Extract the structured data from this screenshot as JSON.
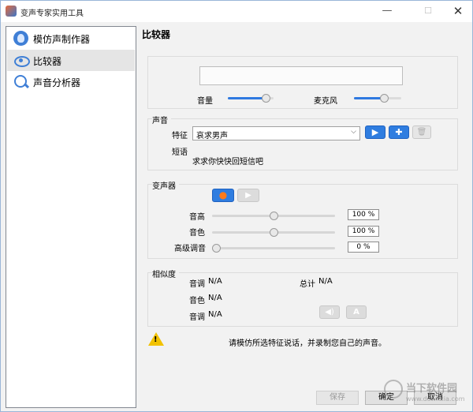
{
  "window": {
    "title": "变声专家实用工具",
    "minimize": "—",
    "maximize": "☐",
    "close": "✕"
  },
  "sidebar": {
    "items": [
      {
        "label": "模仿声制作器",
        "icon": "mimic-voice-icon"
      },
      {
        "label": "比较器",
        "icon": "compare-icon",
        "selected": true
      },
      {
        "label": "声音分析器",
        "icon": "analyze-icon"
      }
    ]
  },
  "page_title": "比较器",
  "levels": {
    "volume_label": "音量",
    "mic_label": "麦克风",
    "volume_value": 0.85,
    "mic_value": 0.65
  },
  "voice": {
    "group_label": "声音",
    "feature_label": "特征",
    "feature_value": "哀求男声",
    "phrase_label": "短语",
    "phrase_text": "求求你快快回短信吧",
    "play_glyph": "▶",
    "add_glyph": "✚",
    "delete_glyph": "🗑"
  },
  "changer": {
    "group_label": "变声器",
    "record_glyph": "●",
    "play_glyph": "▶",
    "pitch_label": "音高",
    "pitch_value": "100 %",
    "timbre_label": "音色",
    "timbre_value": "100 %",
    "advanced_label": "高级调音",
    "advanced_value": "0 %"
  },
  "similarity": {
    "group_label": "相似度",
    "tone_label": "音调",
    "tone_value": "N/A",
    "total_label": "总计",
    "total_value": "N/A",
    "timbre_label": "音色",
    "timbre_value": "N/A",
    "tone2_label": "音调",
    "tone2_value": "N/A",
    "speaker_glyph": "◀)",
    "font_glyph": "A"
  },
  "hint": {
    "icon": "warning-icon",
    "mark": "!",
    "text": "请模仿所选特征说话，并录制您自己的声音。"
  },
  "footer": {
    "save": "保存",
    "ok": "确定",
    "cancel": "取消"
  },
  "watermark": {
    "text": "当下软件园",
    "url": "www.downxia.com"
  },
  "colors": {
    "accent": "#2f7de0",
    "background": "#f2f2f2",
    "warning": "#f2c200"
  }
}
